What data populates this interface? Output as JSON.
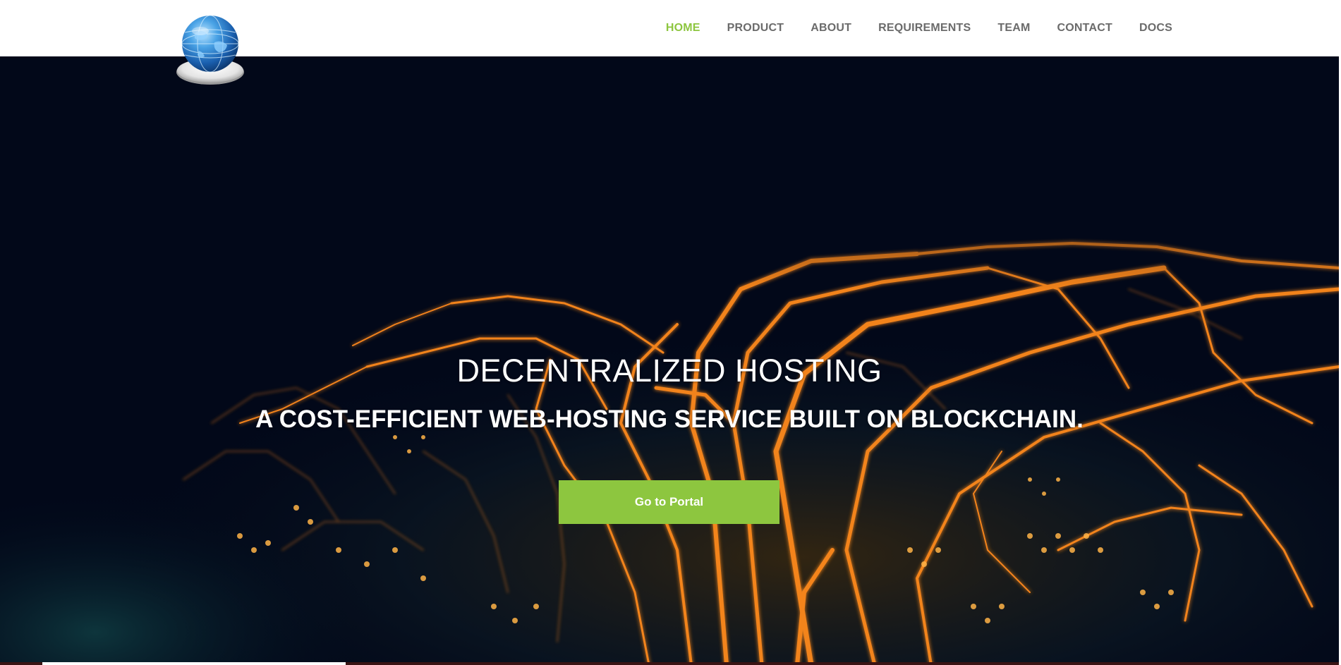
{
  "nav": {
    "items": [
      {
        "label": "HOME",
        "active": true
      },
      {
        "label": "PRODUCT",
        "active": false
      },
      {
        "label": "ABOUT",
        "active": false
      },
      {
        "label": "REQUIREMENTS",
        "active": false
      },
      {
        "label": "TEAM",
        "active": false
      },
      {
        "label": "CONTACT",
        "active": false
      },
      {
        "label": "DOCS",
        "active": false
      }
    ]
  },
  "hero": {
    "title": "DECENTRALIZED HOSTING",
    "subtitle": "A COST-EFFICIENT WEB-HOSTING SERVICE BUILT ON BLOCKCHAIN.",
    "cta_label": "Go to Portal"
  },
  "colors": {
    "accent": "#8dc63f",
    "nav_text": "#6b6b6b",
    "hero_bg": "#020819",
    "circuit": "#ff9a1f"
  },
  "icons": {
    "logo": "globe-logo-icon"
  }
}
